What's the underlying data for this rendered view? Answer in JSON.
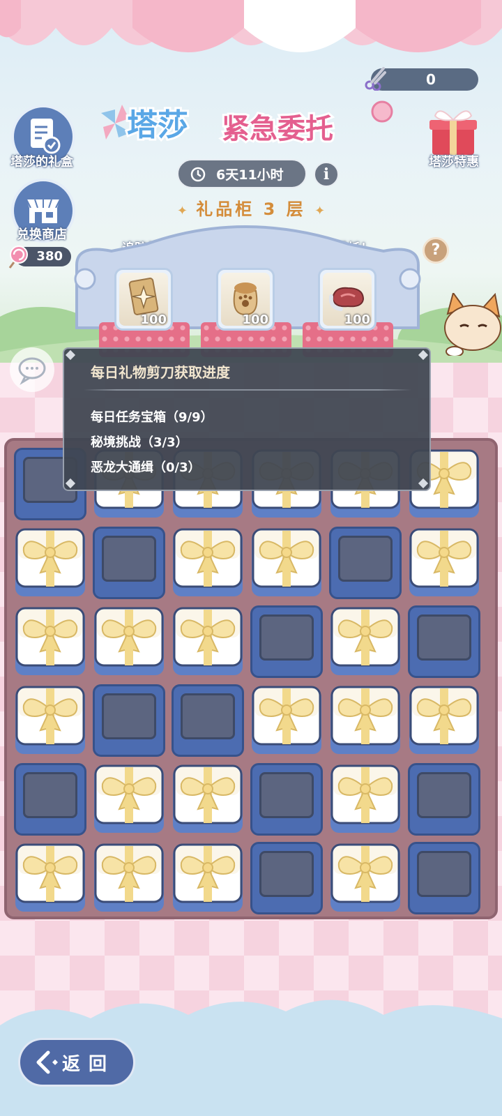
{
  "top": {
    "scissor_count": "0",
    "title_part1": "塔莎",
    "title_part2": "紧急委托",
    "timer": "6天11小时",
    "floor_label": "礼品柜 3 层",
    "hint": "追踪的宝藏藏在礼盒中，进行剪彩完成委托！"
  },
  "side": {
    "gift_box_label": "塔莎的礼盒",
    "shop_label": "兑换商店",
    "coin_count": "380",
    "deal_label": "塔莎特惠"
  },
  "rewards": [
    {
      "icon": "card-icon",
      "count": "100"
    },
    {
      "icon": "paw-bag-icon",
      "count": "100"
    },
    {
      "icon": "meat-icon",
      "count": "100"
    }
  ],
  "tooltip": {
    "title": "每日礼物剪刀获取进度",
    "items": [
      "每日任务宝箱（9/9）",
      "秘境挑战（3/3）",
      "恶龙大通缉（0/3）"
    ]
  },
  "board": {
    "rows": [
      [
        "empty",
        "gift",
        "gift",
        "gift",
        "gift",
        "gift"
      ],
      [
        "gift",
        "empty",
        "gift",
        "gift",
        "empty",
        "gift"
      ],
      [
        "gift",
        "gift",
        "gift",
        "empty",
        "gift",
        "empty"
      ],
      [
        "gift",
        "empty",
        "empty",
        "gift",
        "gift",
        "gift"
      ],
      [
        "empty",
        "gift",
        "gift",
        "empty",
        "gift",
        "empty"
      ],
      [
        "gift",
        "gift",
        "gift",
        "empty",
        "gift",
        "empty"
      ]
    ]
  },
  "back_label": "返回",
  "colors": {
    "title_blue": "#5aa7e6",
    "title_pink": "#e45f8f",
    "board": "#a77a84",
    "empty_box": "#4c6cb1",
    "ribbon": "#f2d98c"
  }
}
